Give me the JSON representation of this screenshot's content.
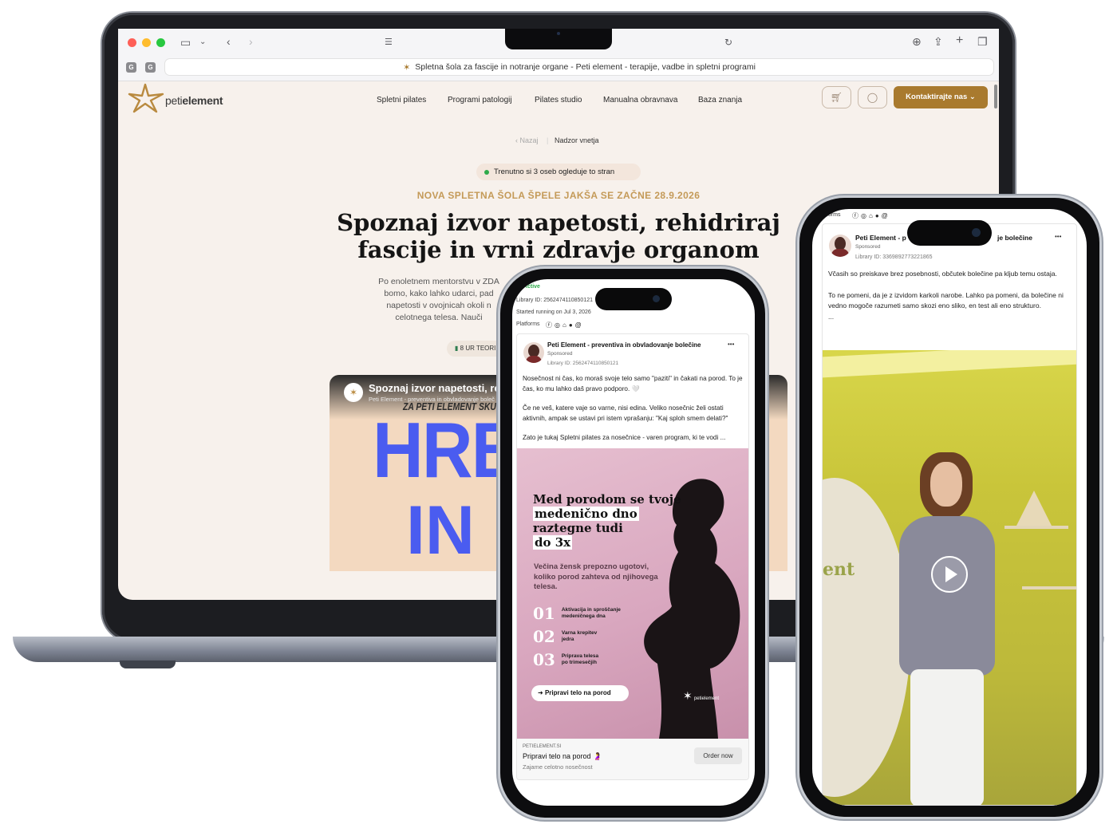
{
  "browser": {
    "url_text": "Spletna šola za fascije in notranje organe - Peti element - terapije, vadbe in spletni programi",
    "ext1": "G",
    "ext2": "G"
  },
  "site": {
    "logo_light": "peti",
    "logo_bold": "element",
    "nav": [
      "Spletni pilates",
      "Programi patologij",
      "Pilates studio",
      "Manualna obravnava",
      "Baza znanja"
    ],
    "cta": "Kontaktirajte nas",
    "breadcrumb_back": "Nazaj",
    "breadcrumb_sep": "|",
    "breadcrumb_current": "Nadzor vnetja",
    "live_badge": "Trenutno si 3 oseb ogleduje to stran",
    "eyebrow": "NOVA SPLETNA ŠOLA ŠPELE JAKŠA SE ZAČNE 28.9.2026",
    "headline_1": "Spoznaj izvor napetosti, rehidriraj",
    "headline_2": "fascije in vrni zdravje organom",
    "intro": [
      "Po enoletnem mentorstvu v ZDA",
      "bomo, kako lahko udarci, pad",
      "napetosti v ovojnicah okoli n",
      "celotnega telesa. Nauči"
    ],
    "hours_chip": "8 UR TEORI",
    "video_title": "Spoznaj izvor napetosti, reh",
    "video_sub": "Peti Element - preventiva in obvladovanje boleč",
    "video_banner": "ZA PETI ELEMENT SKUP",
    "video_big_1": "HRB",
    "video_big_2": "IN"
  },
  "phone1": {
    "status": "Active",
    "library_id": "Library ID: 2562474110850121",
    "started": "Started running on Jul 3, 2026",
    "platforms": "Platforms",
    "page_name": "Peti Element - preventiva in obvladovanje bolečine",
    "sponsored": "Sponsored",
    "post_library_id": "Library ID: 2562474110850121",
    "more": "•••",
    "body_1": "Nosečnost ni čas, ko moraš svoje telo samo \"paziti\" in čakati na porod. To je čas, ko mu lahko daš pravo podporo. 🤍",
    "body_2": "Če ne veš, katere vaje so varne, nisi edina. Veliko nosečnic želi ostati aktivnih, ampak se ustavi pri istem vprašanju: \"Kaj sploh smem delati?\"",
    "body_3": "Zato je tukaj Spletni pilates za nosečnice - varen program, ki te vodi ...",
    "creative_title": [
      "Med porodom se tvoje",
      "medenično dno",
      "raztegne tudi",
      "do 3x"
    ],
    "creative_text": "Večina žensk prepozno ugotovi, koliko porod zahteva od njihovega telesa.",
    "steps": [
      {
        "num": "01",
        "label": "Aktivacija in sproščanje medeničnega dna"
      },
      {
        "num": "02",
        "label": "Varna krepitev jedra"
      },
      {
        "num": "03",
        "label": "Priprava telesa po trimesečjih"
      }
    ],
    "creative_button": "Pripravi telo na porod",
    "creative_logo": "petielement",
    "link_domain": "PETIELEMENT.SI",
    "link_title": "Pripravi telo na porod 🤰",
    "link_desc": "Zajame celotno nosečnost",
    "link_button": "Order now"
  },
  "phone2": {
    "platforms": "tforms",
    "page_name_left": "Peti Element - p",
    "page_name_right": "je bolečine",
    "sponsored": "Sponsored",
    "library_id": "Library ID: 3369892773221865",
    "more": "•••",
    "body_1": "Včasih so preiskave brez posebnosti, občutek bolečine pa kljub temu ostaja.",
    "body_2": "To ne pomeni, da je z izvidom karkoli narobe. Lahko pa pomeni, da bolečine ni vedno mogoče razumeti samo skozi eno sliko, en test ali eno strukturo.",
    "ellipsis": "...",
    "wall_text": "ent"
  },
  "colors": {
    "brand_gold": "#a97a2e",
    "eyebrow": "#c49a58",
    "page_bg": "#f7f1ec",
    "live_green": "#2eaa4a",
    "video_blue": "#4a5cf0",
    "creative_pink": "#d9a7bf"
  }
}
